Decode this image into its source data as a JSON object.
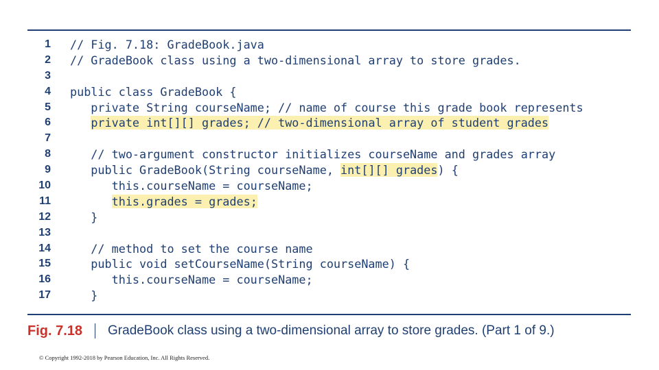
{
  "code": {
    "lines": [
      {
        "num": "1",
        "text": "// Fig. 7.18: GradeBook.java",
        "hl_text": "",
        "tail": ""
      },
      {
        "num": "2",
        "text": "// GradeBook class using a two-dimensional array to store grades.",
        "hl_text": "",
        "tail": ""
      },
      {
        "num": "3",
        "text": "",
        "hl_text": "",
        "tail": ""
      },
      {
        "num": "4",
        "text": "public class GradeBook {",
        "hl_text": "",
        "tail": ""
      },
      {
        "num": "5",
        "text": "   private String courseName; // name of course this grade book represents",
        "hl_text": "",
        "tail": ""
      },
      {
        "num": "6",
        "text": "   ",
        "hl_text": "private int[][] grades; // two-dimensional array of student grades",
        "tail": ""
      },
      {
        "num": "7",
        "text": "",
        "hl_text": "",
        "tail": ""
      },
      {
        "num": "8",
        "text": "   // two-argument constructor initializes courseName and grades array",
        "hl_text": "",
        "tail": ""
      },
      {
        "num": "9",
        "text": "   public GradeBook(String courseName, ",
        "hl_text": "int[][] grades",
        "tail": ") {"
      },
      {
        "num": "10",
        "text": "      this.courseName = courseName;",
        "hl_text": "",
        "tail": ""
      },
      {
        "num": "11",
        "text": "      ",
        "hl_text": "this.grades = grades;",
        "tail": ""
      },
      {
        "num": "12",
        "text": "   }",
        "hl_text": "",
        "tail": ""
      },
      {
        "num": "13",
        "text": "",
        "hl_text": "",
        "tail": ""
      },
      {
        "num": "14",
        "text": "   // method to set the course name",
        "hl_text": "",
        "tail": ""
      },
      {
        "num": "15",
        "text": "   public void setCourseName(String courseName) {",
        "hl_text": "",
        "tail": ""
      },
      {
        "num": "16",
        "text": "      this.courseName = courseName;",
        "hl_text": "",
        "tail": ""
      },
      {
        "num": "17",
        "text": "   }",
        "hl_text": "",
        "tail": ""
      }
    ]
  },
  "caption": {
    "label": "Fig. 7.18",
    "text": "GradeBook class using a two-dimensional array to store grades. (Part 1 of 9.)"
  },
  "copyright": "© Copyright 1992-2018 by Pearson Education, Inc. All Rights Reserved.",
  "colors": {
    "code_text": "#1f3f73",
    "highlight": "#fbf0b0",
    "fig_label": "#c8322b"
  }
}
